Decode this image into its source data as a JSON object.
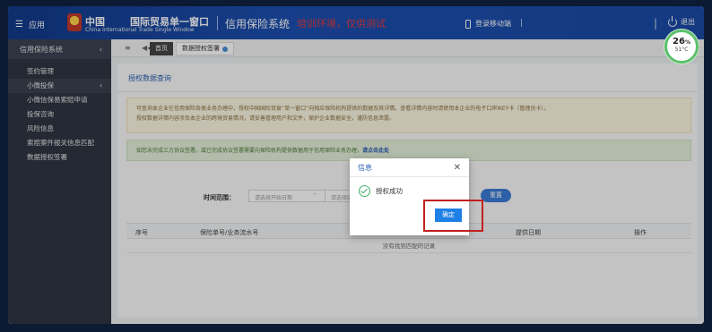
{
  "header": {
    "menu_label": "应用",
    "logo_cn": "中国",
    "logo_cn_title": "国际贸易单一窗口",
    "logo_en": "China International Trade Single Window",
    "system_title": "信用保险系统",
    "env_note": "培训环境，仅供测试",
    "mobile_login": "登录移动端",
    "separator": "|",
    "logout": "退出"
  },
  "sidebar": {
    "title": "信用保险系统",
    "items": [
      {
        "label": "签约管理"
      },
      {
        "label": "小微投保",
        "group": true
      },
      {
        "label": "小微信保易索赔申请"
      },
      {
        "label": "投保咨询"
      },
      {
        "label": "风险信息"
      },
      {
        "label": "索赔案件报关信息匹配"
      },
      {
        "label": "数据授权签署"
      }
    ]
  },
  "tabs": {
    "home": "首页",
    "current": "数据授权签署"
  },
  "page": {
    "title": "授权数据查询",
    "notice1_line1": "可查询本企业在信用保险各类业务办理中，授权中国国际贸易“单一窗口”向相应保险机构提供的数据及其详情。查看详情内容时请使用本企业的电子口岸IKEY卡（管理员卡）。",
    "notice1_line2": "授权数据详情内容涉及本企业的跨境贸易情况，请妥善管理用户和文件，保护企业数据安全，谨防信息泄露。",
    "notice2_text": "如您未完成三方协议签署，或已完成协议签署需要向保险机构提供数据用于信用保险业务办理，",
    "notice2_link": "请点击此处",
    "time_label": "时间范围：",
    "start_placeholder": "请选择开始日期",
    "end_placeholder": "请选择结束日期",
    "dash": "-",
    "reset": "重置",
    "columns": [
      "序号",
      "保险单号/业务流水号",
      "提供日期",
      "操作"
    ],
    "empty": "没有找到匹配的记录"
  },
  "dialog": {
    "title": "信息",
    "message": "授权成功",
    "confirm": "确定"
  },
  "gauge": {
    "value": "26",
    "unit": "%",
    "temp": "51°C"
  }
}
